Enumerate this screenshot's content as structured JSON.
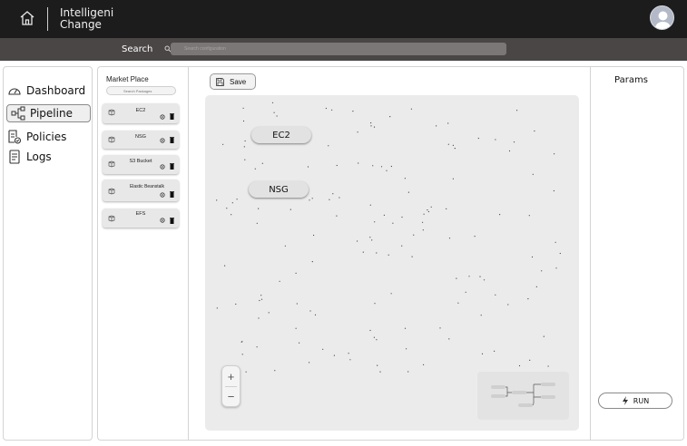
{
  "app": {
    "brand_line1": "Intelligeni",
    "brand_line2": "Change"
  },
  "topbar": {
    "home_icon": "home-icon",
    "avatar_icon": "user-avatar-icon"
  },
  "search": {
    "label": "Search",
    "placeholder": "Search configuration"
  },
  "sidebar": {
    "items": [
      {
        "label": "Dashboard",
        "icon": "gauge-icon",
        "active": false
      },
      {
        "label": "Pipeline",
        "icon": "pipeline-icon",
        "active": true
      },
      {
        "label": "Policies",
        "icon": "policy-icon",
        "active": false
      },
      {
        "label": "Logs",
        "icon": "logs-icon",
        "active": false
      }
    ]
  },
  "market": {
    "title": "Market Place",
    "search_placeholder": "Search Packages",
    "packages": [
      {
        "name": "EC2"
      },
      {
        "name": "NSG"
      },
      {
        "name": "S3 Bucket"
      },
      {
        "name": "Elastic Beanstalk"
      },
      {
        "name": "EFS"
      }
    ]
  },
  "toolbar": {
    "save_label": "Save"
  },
  "canvas": {
    "nodes": [
      {
        "label": "EC2"
      },
      {
        "label": "NSG"
      }
    ],
    "zoom_in_label": "+",
    "zoom_out_label": "−"
  },
  "params": {
    "title": "Params",
    "run_label": "RUN"
  },
  "colors": {
    "topbar": "#1c1c1c",
    "searchbar": "#4a4646",
    "canvas": "#ebebeb",
    "node": "#e2e2e2"
  }
}
